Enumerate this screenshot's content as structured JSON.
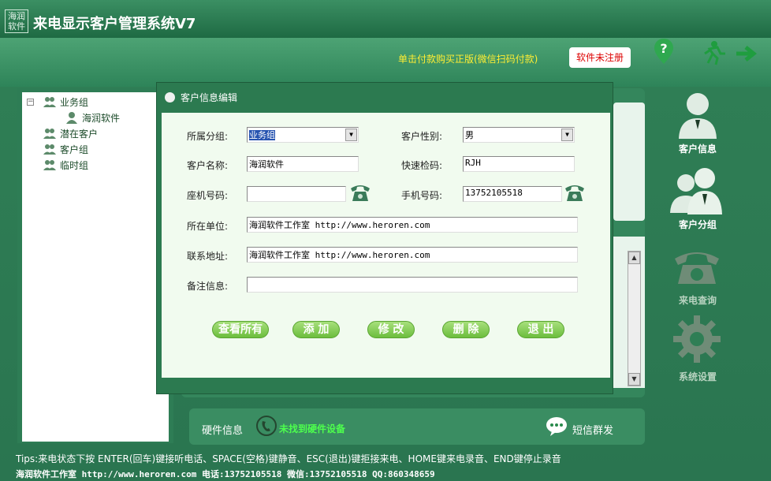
{
  "app": {
    "logo_text": "海润软件",
    "title": "来电显示客户管理系统V7",
    "buy_text": "单击付款购买正版(微信扫码付款)",
    "reg_button": "软件未注册"
  },
  "tree": {
    "groups": [
      {
        "label": "业务组",
        "expanded": true,
        "children": [
          "海润软件"
        ]
      },
      {
        "label": "潜在客户"
      },
      {
        "label": "客户组"
      },
      {
        "label": "临时组"
      }
    ]
  },
  "dialog": {
    "title": "客户信息编辑",
    "fields": {
      "group_label": "所属分组:",
      "group_value": "业务组",
      "gender_label": "客户性别:",
      "gender_value": "男",
      "name_label": "客户名称:",
      "name_value": "海润软件",
      "quick_label": "快速检码:",
      "quick_value": "RJH",
      "phone_label": "座机号码:",
      "phone_value": "",
      "mobile_label": "手机号码:",
      "mobile_value": "13752105518",
      "company_label": "所在单位:",
      "company_value": "海润软件工作室 http://www.heroren.com",
      "address_label": "联系地址:",
      "address_value": "海润软件工作室 http://www.heroren.com",
      "note_label": "备注信息:",
      "note_value": ""
    },
    "buttons": {
      "view_all": "查看所有",
      "add": "添 加",
      "modify": "修 改",
      "delete": "删 除",
      "exit": "退 出"
    }
  },
  "right_nav": {
    "customer_info": "客户信息",
    "customer_group": "客户分组",
    "call_query": "来电查询",
    "settings": "系统设置"
  },
  "hardware": {
    "label": "硬件信息",
    "status": "未找到硬件设备",
    "sms": "短信群发"
  },
  "status": {
    "tips": "Tips:来电状态下按 ENTER(回车)键接听电话、SPACE(空格)键静音、ESC(退出)键拒接来电、HOME键来电录音、END键停止录音",
    "footer": "海润软件工作室 http://www.heroren.com  电话:13752105518  微信:13752105518 QQ:860348659"
  },
  "colors": {
    "accent": "#2c7a50",
    "button": "#7cc64a",
    "hw_status": "#4dff4d",
    "buy_text": "#ffee33"
  }
}
